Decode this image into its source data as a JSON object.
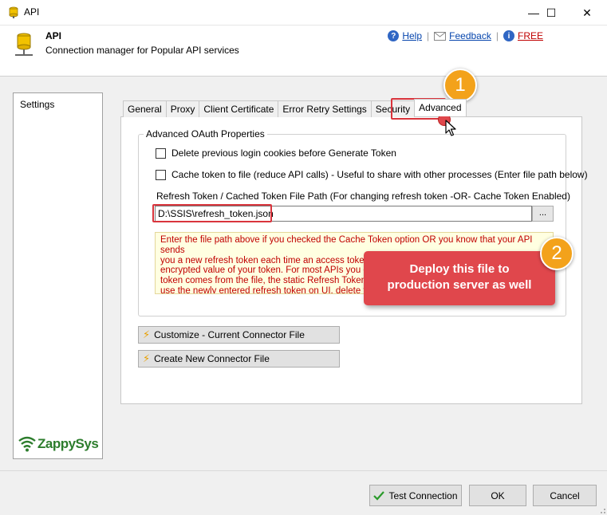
{
  "window": {
    "title": "API",
    "minimize_glyph": "—",
    "maximize_glyph": "☐",
    "close_glyph": "✕"
  },
  "header": {
    "title": "API",
    "subtitle": "Connection manager for Popular API services",
    "help_label": "Help",
    "feedback_label": "Feedback",
    "free_label": "FREE"
  },
  "sidebar": {
    "items": [
      {
        "label": "Settings"
      }
    ],
    "logo_text": "ZappySys"
  },
  "tabs": [
    {
      "label": "General"
    },
    {
      "label": "Proxy"
    },
    {
      "label": "Client Certificate"
    },
    {
      "label": "Error Retry Settings"
    },
    {
      "label": "Security"
    },
    {
      "label": "Advanced",
      "active": true
    }
  ],
  "advanced": {
    "group_title": "Advanced OAuth Properties",
    "delete_cookies_label": "Delete previous login cookies before Generate Token",
    "cache_token_label": "Cache token to file (reduce API calls) - Useful to share with other processes (Enter file path below)",
    "path_label": "Refresh Token / Cached Token File Path (For changing refresh token -OR- Cache Token Enabled)",
    "path_value": "D:\\SSIS\\refresh_token.json",
    "browse_label": "...",
    "hint_line1": "Enter the file path above if you checked the Cache Token option OR you know that your API sends",
    "hint_line2": "you a new refresh token each time an access token is requested. The above file stores the",
    "hint_line3": "encrypted value of your token. For most APIs you do not need to specify a file. When refresh",
    "hint_line4": "token comes from the file, the static Refresh Token on the UI is ignored. If you wish to",
    "hint_line5": "use the newly entered refresh token on UI, delete the file"
  },
  "connector_buttons": {
    "customize_label": "Customize - Current Connector File",
    "create_label": "Create New Connector File"
  },
  "annotations": {
    "badge1": "1",
    "badge2": "2",
    "callout_line1": "Deploy this file to",
    "callout_line2": "production server as well"
  },
  "footer": {
    "test_label": "Test Connection",
    "ok_label": "OK",
    "cancel_label": "Cancel"
  },
  "colors": {
    "accent_red": "#e0474c",
    "badge_orange": "#f3a21b",
    "hint_text": "#c00000",
    "link_blue": "#0645ad"
  }
}
